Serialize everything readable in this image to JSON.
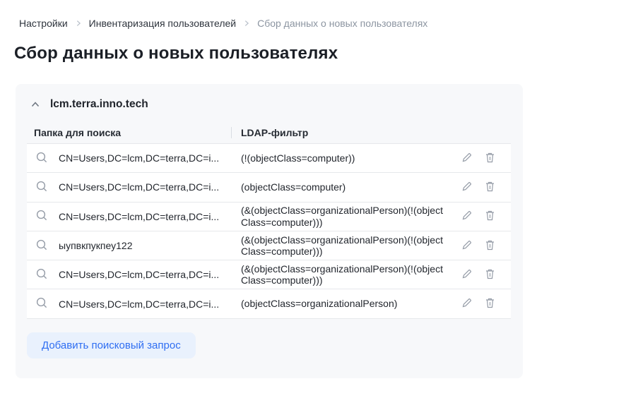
{
  "breadcrumb": {
    "items": [
      {
        "label": "Настройки"
      },
      {
        "label": "Инвентаризация пользователей"
      },
      {
        "label": "Сбор данных о новых пользователях"
      }
    ]
  },
  "page": {
    "title": "Сбор данных о новых пользователях"
  },
  "panel": {
    "domain": "lcm.terra.inno.tech",
    "table": {
      "headers": [
        "Папка для поиска",
        "LDAP-фильтр"
      ],
      "rows": [
        {
          "folder": "CN=Users,DC=lcm,DC=terra,DC=i...",
          "filter": "(!(objectClass=computer))"
        },
        {
          "folder": "CN=Users,DC=lcm,DC=terra,DC=i...",
          "filter": "(objectClass=computer)"
        },
        {
          "folder": "CN=Users,DC=lcm,DC=terra,DC=i...",
          "filter": "(&(objectClass=organizationalPerson)(!(objectClass=computer)))"
        },
        {
          "folder": "ыупвкпукпеу122",
          "filter": "(&(objectClass=organizationalPerson)(!(objectClass=computer)))"
        },
        {
          "folder": "CN=Users,DC=lcm,DC=terra,DC=i...",
          "filter": "(&(objectClass=organizationalPerson)(!(objectClass=computer)))"
        },
        {
          "folder": "CN=Users,DC=lcm,DC=terra,DC=i...",
          "filter": "(objectClass=organizationalPerson)"
        }
      ]
    },
    "add_button_label": "Добавить поисковый запрос"
  },
  "icons": {
    "chevron-right": "breadcrumb separator ›",
    "chevron-up": "collapse section ∧",
    "search": "magnifier glyph",
    "edit": "pencil glyph",
    "delete": "trash-can glyph"
  },
  "colors": {
    "accent_blue": "#2f6ef2",
    "button_bg": "#e9f1fd",
    "panel_bg": "#f7f8fa",
    "row_border": "#e6e8eb",
    "icon_gray": "#959ca7",
    "breadcrumb_muted": "#8c95a1",
    "text_dark": "#23272f"
  }
}
